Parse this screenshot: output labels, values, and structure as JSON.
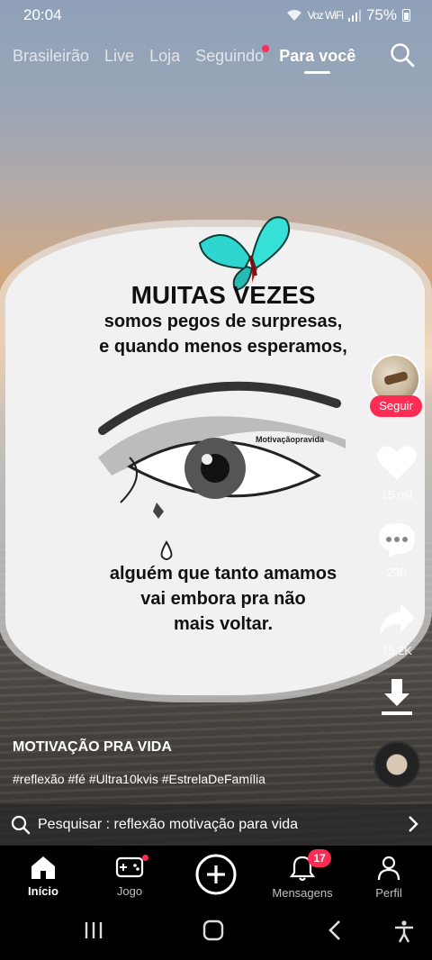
{
  "status_bar": {
    "time": "20:04",
    "network": "Voz WiFi",
    "battery": "75%"
  },
  "top_tabs": [
    {
      "label": "Brasileirão",
      "active": false,
      "dot": false
    },
    {
      "label": "Live",
      "active": false,
      "dot": false
    },
    {
      "label": "Loja",
      "active": false,
      "dot": false
    },
    {
      "label": "Seguindo",
      "active": false,
      "dot": true
    },
    {
      "label": "Para você",
      "active": true,
      "dot": false
    }
  ],
  "video": {
    "card": {
      "title": "MUITAS VEZES",
      "lines_top": [
        "somos pegos de surpresas,",
        "e quando menos esperamos,"
      ],
      "watermark": "Motivaçãopravida",
      "lines_bottom": [
        "alguém que tanto amamos",
        "vai embora pra não",
        "mais voltar."
      ]
    },
    "author": "MOTIVAÇÃO PRA VIDA",
    "hashtags": "#reflexão #fé #Ultra10kvis #EstrelaDeFamília"
  },
  "actions": {
    "follow_label": "Seguir",
    "likes": "15 mil",
    "comments": "230",
    "shares": "15,2K"
  },
  "search_suggestion": {
    "label": "Pesquisar : reflexão motivação para vida"
  },
  "bottom_nav": {
    "home": "Início",
    "game": "Jogo",
    "messages": "Mensagens",
    "messages_badge": "17",
    "profile": "Perfil"
  },
  "colors": {
    "accent": "#fe2c55",
    "butterfly": "#2fd6cf"
  }
}
